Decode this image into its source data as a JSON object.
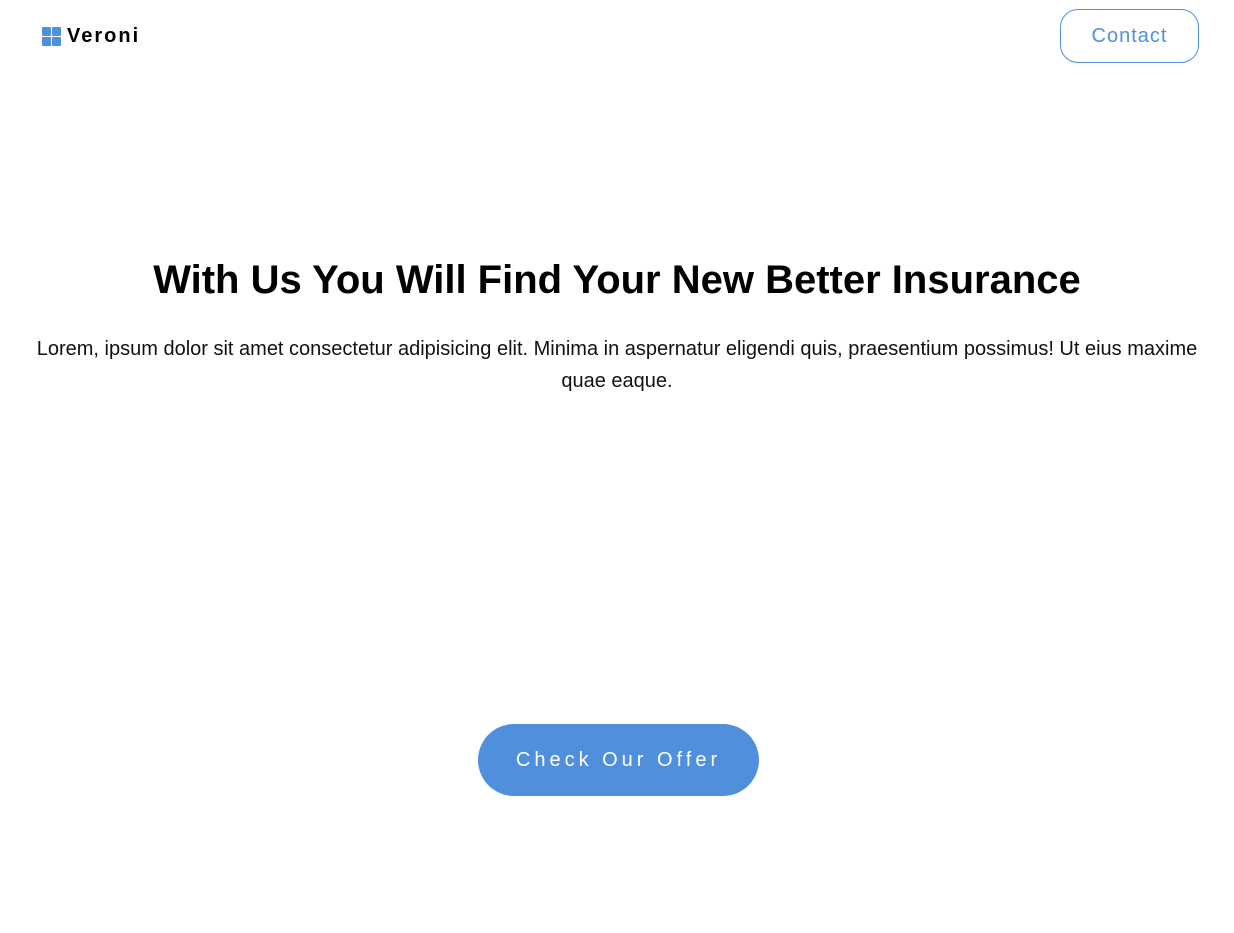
{
  "header": {
    "brand": {
      "name": "Veroni",
      "icon": "grid-logo-icon"
    },
    "contact_label": "Contact"
  },
  "hero": {
    "title": "With Us You Will Find Your New Better Insurance",
    "description": "Lorem, ipsum dolor sit amet consectetur adipisicing elit. Minima in aspernatur eligendi quis, praesentium possimus! Ut eius maxime quae eaque.",
    "cta_label": "Check Our Offer"
  },
  "colors": {
    "accent": "#4f8fdc",
    "text": "#000000",
    "background": "#ffffff"
  }
}
